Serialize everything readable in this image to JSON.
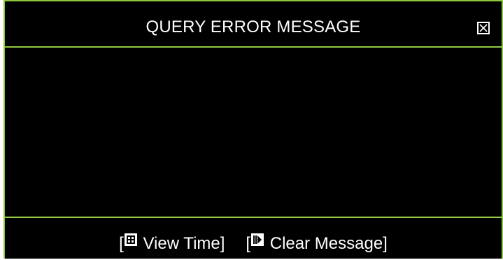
{
  "dialog": {
    "title": "QUERY ERROR MESSAGE",
    "message": "",
    "close_icon": "close-box-icon"
  },
  "footer": {
    "actions": [
      {
        "bracket_open": "[",
        "icon": "grid-key-icon",
        "label": "View Time",
        "bracket_close": "]"
      },
      {
        "bracket_open": "[",
        "icon": "step-key-icon",
        "label": "Clear Message",
        "bracket_close": "]"
      }
    ]
  },
  "colors": {
    "background": "#000000",
    "border": "#8fc740",
    "text": "#ffffff"
  }
}
